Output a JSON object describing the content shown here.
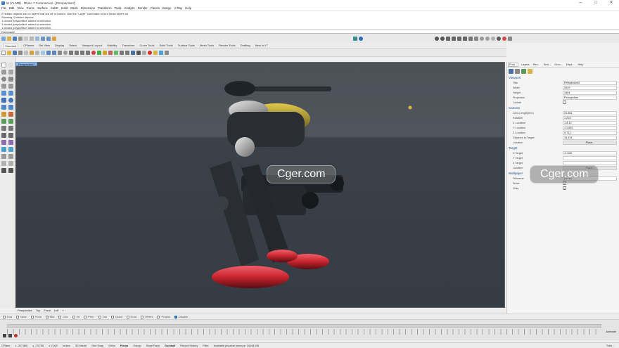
{
  "window": {
    "title": "M (71 MB) - Rhino 7 Commercial - [Perspective7]"
  },
  "menu": [
    "File",
    "Edit",
    "View",
    "Curve",
    "Surface",
    "SubD",
    "Solid",
    "Mesh",
    "Dimension",
    "Transform",
    "Tools",
    "Analyze",
    "Render",
    "Panels",
    "Bongo",
    "V-Ray",
    "Help"
  ],
  "command_history": [
    "2 hidden objects are on layers that are off or locked.  Use the \"Layer\" command to turn these layers on.",
    "Showing 3 hidden objects.",
    "1 closed polysurface added to selection.",
    "1 closed polysurface added to selection.",
    "1 closed polysurface added to selection."
  ],
  "command_prompt": "Command:",
  "toolbar_tabs": [
    "Standard",
    "CPlanes",
    "Set View",
    "Display",
    "Select",
    "Viewport Layout",
    "Visibility",
    "Transform",
    "Curve Tools",
    "Solid Tools",
    "Surface Tools",
    "Mesh Tools",
    "Render Tools",
    "Drafting",
    "New in V7"
  ],
  "viewport": {
    "tab_label": "Perspective7"
  },
  "watermarks": [
    "Cger.com",
    "Cger.com"
  ],
  "view_tabs": [
    "Perspective",
    "Top",
    "Front",
    "Left",
    "+"
  ],
  "osnaps": [
    {
      "label": "End",
      "on": false
    },
    {
      "label": "Near",
      "on": false
    },
    {
      "label": "Point",
      "on": false
    },
    {
      "label": "Mid",
      "on": false
    },
    {
      "label": "Cen",
      "on": false
    },
    {
      "label": "Int",
      "on": false
    },
    {
      "label": "Perp",
      "on": false
    },
    {
      "label": "Tan",
      "on": false
    },
    {
      "label": "Quad",
      "on": false
    },
    {
      "label": "Knot",
      "on": false
    },
    {
      "label": "Vertex",
      "on": false
    },
    {
      "label": "Project",
      "on": false
    },
    {
      "label": "Disable",
      "on": true
    }
  ],
  "timeline": {
    "label": "Animate",
    "marker_fraction": 0.0
  },
  "status_bar": {
    "cplane": "CPlane",
    "x": "x -327.860",
    "y": "y -73.708",
    "z": "z 0.000",
    "units": "Inches",
    "layer": "3D Model",
    "grid_snap": "Grid Snap",
    "ortho": "Ortho",
    "planar": "Planar",
    "osnap": "Osnap",
    "smarttrack": "SmartTrack",
    "gumball": "Gumball",
    "record_history": "Record History",
    "filter": "Filter",
    "memory": "Available physical memory: 34448 MB",
    "tolerance": "Toler..."
  },
  "panel": {
    "tabs": [
      "Prop...",
      "Layers",
      "Ren...",
      "Envi...",
      "Grou...",
      "Displ...",
      "Help"
    ],
    "sections": {
      "viewport": {
        "title": "Viewport",
        "rows": [
          {
            "label": "Title",
            "value": "Perspective3"
          },
          {
            "label": "Width",
            "value": "2029"
          },
          {
            "label": "Height",
            "value": "1464"
          },
          {
            "label": "Projection",
            "value": "Perspective"
          },
          {
            "label": "Locked",
            "value": ""
          }
        ]
      },
      "camera": {
        "title": "Camera",
        "rows": [
          {
            "label": "Lens Length(mm)",
            "value": "24.851"
          },
          {
            "label": "Rotation",
            "value": "1.203"
          },
          {
            "label": "X Location",
            "value": "-18.12"
          },
          {
            "label": "Y Location",
            "value": "-11.652"
          },
          {
            "label": "Z Location",
            "value": "9.711"
          },
          {
            "label": "Distance to Target",
            "value": "18.431"
          },
          {
            "label": "Location",
            "value": "Place..."
          }
        ]
      },
      "target": {
        "title": "Target",
        "rows": [
          {
            "label": "X Target",
            "value": "-2.328"
          },
          {
            "label": "Y Target",
            "value": ""
          },
          {
            "label": "Z Target",
            "value": ""
          },
          {
            "label": "Location",
            "value": "Place..."
          }
        ]
      },
      "wallpaper": {
        "title": "Wallpaper",
        "rows": [
          {
            "label": "Filename",
            "value": "(none)"
          },
          {
            "label": "Show",
            "value": "✓"
          },
          {
            "label": "Gray",
            "value": "✓"
          }
        ]
      }
    }
  },
  "colors": {
    "viewport_bg": "#3b4149",
    "robot_red": "#c8242e",
    "robot_body": "#2a2d31",
    "robot_yellow": "#c9b23a",
    "accent": "#2a6ebd"
  }
}
